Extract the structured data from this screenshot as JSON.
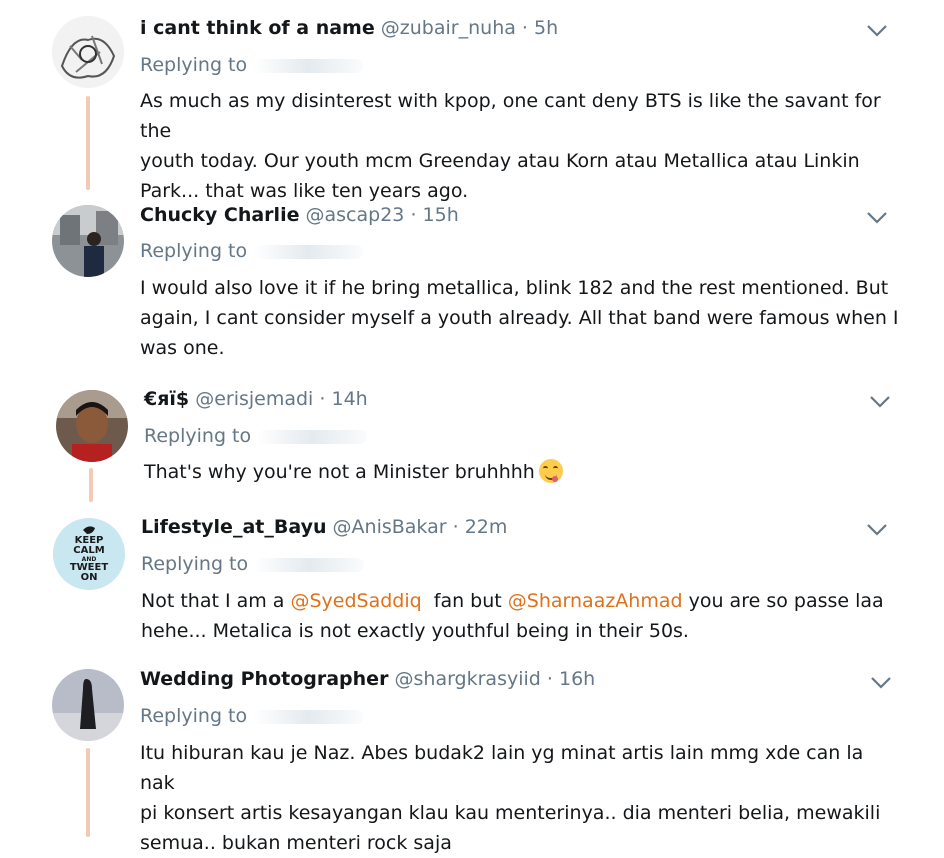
{
  "tweets": [
    {
      "name": "i cant think of a name",
      "handle": "@zubair_nuha",
      "dot": "·",
      "time": "5h",
      "replying": "Replying to",
      "lines": [
        "As much as my disinterest with kpop, one cant deny BTS is like the savant for the",
        "youth today. Our youth mcm Greenday atau Korn atau Metallica atau Linkin",
        "Park... that was like ten years ago."
      ]
    },
    {
      "name": "Chucky Charlie",
      "handle": "@ascap23",
      "dot": "·",
      "time": "15h",
      "replying": "Replying to",
      "lines": [
        "I would also love it if he bring metallica, blink 182 and the rest mentioned. But",
        "again, I cant consider myself a youth already.  All that band were famous when I",
        "was one."
      ]
    },
    {
      "name": "€яï$",
      "handle": "@erisjemadi",
      "dot": "·",
      "time": "14h",
      "replying": "Replying to",
      "lines": [
        "That's why you're not a Minister bruhhhh"
      ],
      "emoji": "face-savoring-food-emoji"
    },
    {
      "name": "Lifestyle_at_Bayu",
      "handle": "@AnisBakar",
      "dot": "·",
      "time": "22m",
      "replying": "Replying to",
      "avatar_text": [
        "KEEP",
        "CALM",
        "AND",
        "TWEET",
        "ON"
      ],
      "line1_a": "Not that I am a ",
      "mention1": "@SyedSaddiq",
      "line1_b": "  fan but ",
      "mention2": "@SharnaazAhmad",
      "line1_c": " you are so passe laa",
      "line2": "hehe... Metalica is not exactly youthful being in their 50s."
    },
    {
      "name": "Wedding Photographer",
      "handle": "@shargkrasyiid",
      "dot": "·",
      "time": "16h",
      "replying": "Replying to",
      "lines": [
        "Itu hiburan kau je Naz. Abes budak2 lain yg minat artis lain mmg xde can la nak",
        "pi konsert artis kesayangan klau kau menterinya.. dia menteri belia, mewakili",
        "semua.. bukan menteri rock saja"
      ]
    }
  ],
  "colors": {
    "name": "#14171a",
    "secondary": "#657786",
    "mention": "#e0711b",
    "thread": "#f3c9b8"
  }
}
